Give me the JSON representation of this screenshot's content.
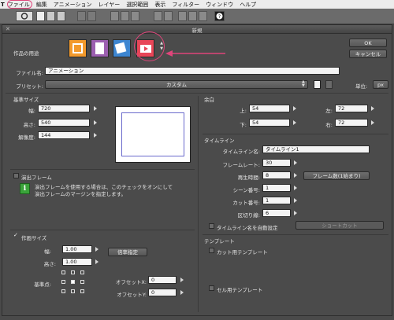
{
  "menubar": {
    "app_letter": "T",
    "items": [
      "ファイル",
      "編集",
      "アニメーション",
      "レイヤー",
      "選択範囲",
      "表示",
      "フィルター",
      "ウィンドウ",
      "ヘルプ"
    ]
  },
  "dialog": {
    "title": "新規",
    "ok_label": "OK",
    "cancel_label": "キャンセル",
    "purpose_label": "作品の用途",
    "filename_label": "ファイル名:",
    "filename_value": "アニメーション",
    "preset_label": "プリセット:",
    "preset_value": "カスタム",
    "unit_label": "単位:",
    "unit_value": "px"
  },
  "basic_size": {
    "header": "基準サイズ",
    "width_label": "幅:",
    "width_value": "720",
    "height_label": "高さ:",
    "height_value": "540",
    "resolution_label": "解像度:",
    "resolution_value": "144"
  },
  "bleed": {
    "header": "演出フレーム",
    "info_text_1": "演出フレームを使用する場合は、このチェックをオンにして",
    "info_text_2": "演出フレームのマージンを指定します。"
  },
  "work_size": {
    "header": "作画サイズ",
    "width_label": "幅:",
    "width_value": "1.00",
    "height_label": "高さ:",
    "height_value": "1.00",
    "scale_button": "倍率指定",
    "anchor_label": "基準点:",
    "offset_x_label": "オフセットX:",
    "offset_x_value": "0",
    "offset_y_label": "オフセットY:",
    "offset_y_value": "0"
  },
  "margin": {
    "header": "余白",
    "top_label": "上:",
    "top_value": "54",
    "bottom_label": "下:",
    "bottom_value": "54",
    "left_label": "左:",
    "left_value": "72",
    "right_label": "右:",
    "right_value": "72"
  },
  "timeline": {
    "header": "タイムライン",
    "name_label": "タイムライン名:",
    "name_value": "タイムライン1",
    "framerate_label": "フレームレート:",
    "framerate_value": "30",
    "playback_label": "再生時間:",
    "playback_value": "8",
    "frames_button": "フレーム数(1始まり)",
    "scene_label": "シーン番号:",
    "scene_value": "1",
    "cut_label": "カット番号:",
    "cut_value": "1",
    "divider_label": "区切り線:",
    "divider_value": "6",
    "autoset_label": "タイムライン名を自動設定",
    "shortcut_button": "ショートカット"
  },
  "template": {
    "header": "テンプレート",
    "cut_template_label": "カット用テンプレート",
    "cel_template_label": "セル用テンプレート"
  },
  "colors": {
    "highlight": "#e0457b"
  }
}
